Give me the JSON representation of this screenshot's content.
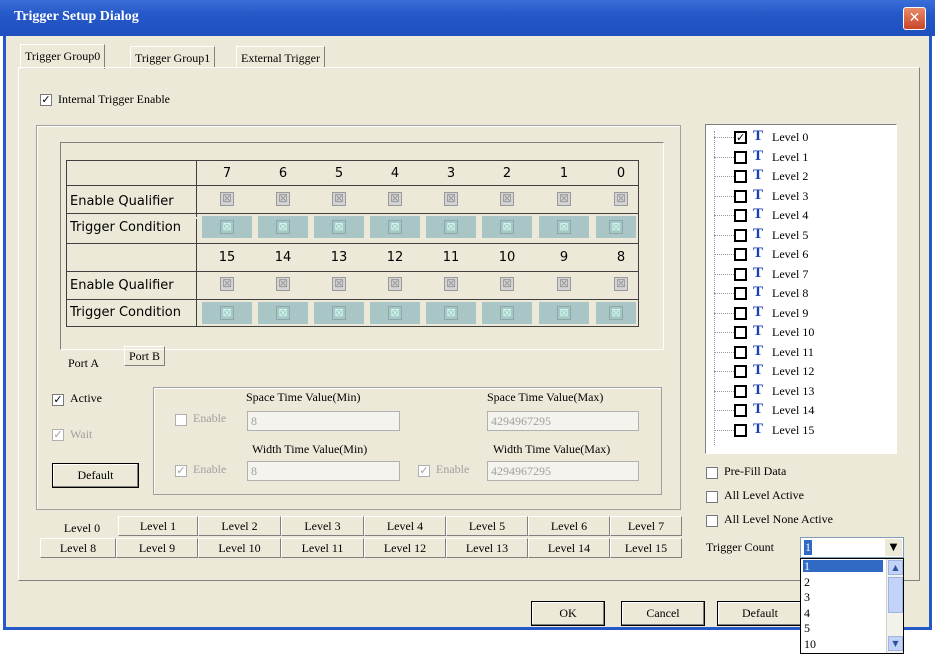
{
  "window": {
    "title": "Trigger Setup Dialog",
    "close_label": "✕"
  },
  "tabs": [
    "Trigger Group0",
    "Trigger Group1",
    "External Trigger"
  ],
  "internal_trigger": {
    "label": "Internal Trigger Enable",
    "checked": "✓"
  },
  "matrix": {
    "top_columns": [
      "7",
      "6",
      "5",
      "4",
      "3",
      "2",
      "1",
      "0"
    ],
    "bottom_columns": [
      "15",
      "14",
      "13",
      "12",
      "11",
      "10",
      "9",
      "8"
    ],
    "row_labels": [
      "Enable Qualifier",
      "Trigger Condition",
      "Enable Qualifier",
      "Trigger Condition"
    ],
    "cell_glyph": "⊠"
  },
  "port_tabs": [
    "Port A",
    "Port B"
  ],
  "options": {
    "active_label": "Active",
    "active_check": "✓",
    "wait_label": "Wait",
    "wait_check": "✓",
    "default_label": "Default"
  },
  "timing": {
    "space_min_label": "Space Time Value(Min)",
    "space_max_label": "Space Time Value(Max)",
    "width_min_label": "Width Time Value(Min)",
    "width_max_label": "Width Time Value(Max)",
    "enable_label": "Enable",
    "space_min_value": "8",
    "space_max_value": "4294967295",
    "width_min_value": "8",
    "width_max_value": "4294967295",
    "enable_check": "✓"
  },
  "level_tabs_row1": [
    "Level 0",
    "Level 1",
    "Level 2",
    "Level 3",
    "Level 4",
    "Level 5",
    "Level 6",
    "Level 7"
  ],
  "level_tabs_row2": [
    "Level 8",
    "Level 9",
    "Level 10",
    "Level 11",
    "Level 12",
    "Level 13",
    "Level 14",
    "Level 15"
  ],
  "tree": {
    "items": [
      "Level 0",
      "Level 1",
      "Level 2",
      "Level 3",
      "Level 4",
      "Level 5",
      "Level 6",
      "Level 7",
      "Level 8",
      "Level 9",
      "Level 10",
      "Level 11",
      "Level 12",
      "Level 13",
      "Level 14",
      "Level 15"
    ],
    "checked_index": 0,
    "check_glyph": "✓",
    "t_glyph": "T"
  },
  "right_options": {
    "prefill": "Pre-Fill Data",
    "all_active": "All Level Active",
    "all_none": "All Level None Active",
    "trigger_count_label": "Trigger Count",
    "trigger_count_value": "1",
    "dropdown_arrow": "▼"
  },
  "dropdown": {
    "options": [
      "1",
      "2",
      "3",
      "4",
      "5",
      "10"
    ],
    "up": "▲",
    "down": "▼"
  },
  "buttons": {
    "ok": "OK",
    "cancel": "Cancel",
    "default": "Default"
  }
}
